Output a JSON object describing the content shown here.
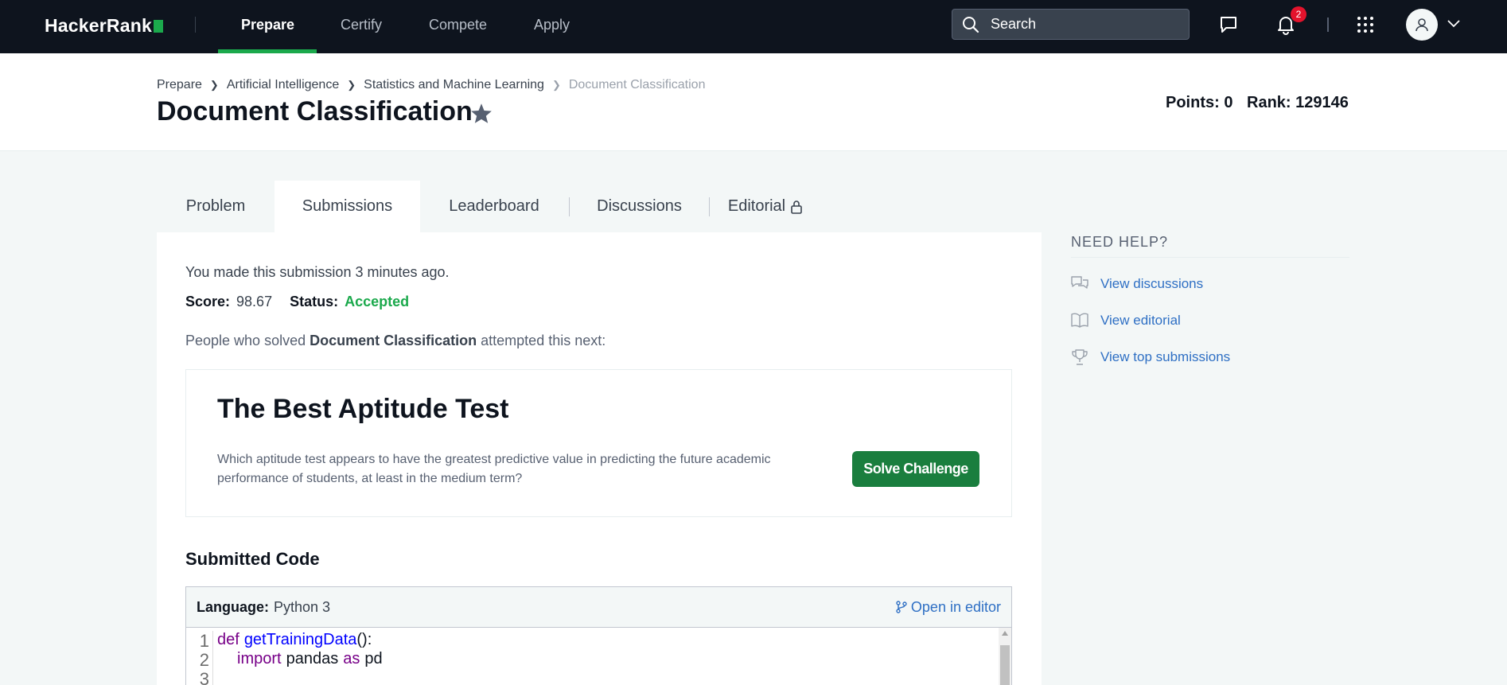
{
  "nav": {
    "logo": "HackerRank",
    "links": [
      "Prepare",
      "Certify",
      "Compete",
      "Apply"
    ],
    "active": "Prepare",
    "search_placeholder": "Search",
    "notifications_count": "2"
  },
  "breadcrumb": [
    "Prepare",
    "Artificial Intelligence",
    "Statistics and Machine Learning",
    "Document Classification"
  ],
  "title": "Document Classification",
  "stats": {
    "points": "Points: 0",
    "rank": "Rank: 129146"
  },
  "tabs": [
    "Problem",
    "Submissions",
    "Leaderboard",
    "Discussions",
    "Editorial"
  ],
  "active_tab": "Submissions",
  "submission": {
    "made": "You made this submission 3 minutes ago.",
    "score_label": "Score:",
    "score": "98.67",
    "status_label": "Status:",
    "status": "Accepted",
    "people_pre": "People who solved ",
    "people_bold": "Document Classification",
    "people_post": " attempted this next:"
  },
  "next_challenge": {
    "title": "The Best Aptitude Test",
    "description": "Which aptitude test appears to have the greatest predictive value in predicting the future academic performance of students, at least in the medium term?",
    "button": "Solve Challenge"
  },
  "code": {
    "heading": "Submitted Code",
    "language_label": "Language:",
    "language": "Python 3",
    "open_editor": "Open in editor",
    "lines": [
      {
        "num": "1",
        "kw1": "def",
        "name": "getTrainingData",
        "rest": "():"
      },
      {
        "num": "2",
        "kw1": "import",
        "name": "pandas",
        "kw2": "as",
        "rest": "pd"
      },
      {
        "num": "3"
      }
    ]
  },
  "help": {
    "title": "NEED HELP?",
    "items": [
      "View discussions",
      "View editorial",
      "View top submissions"
    ]
  },
  "colors": {
    "nav_bg": "#0e141e",
    "accent_green": "#1ba94c",
    "button_green": "#1a7e3e",
    "link_blue": "#2e6fc4",
    "badge_red": "#e3132c"
  }
}
